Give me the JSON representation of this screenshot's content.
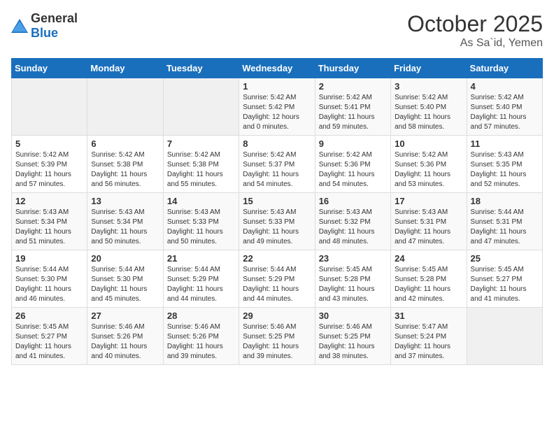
{
  "logo": {
    "text_general": "General",
    "text_blue": "Blue"
  },
  "title": {
    "month": "October 2025",
    "location": "As Sa`id, Yemen"
  },
  "weekdays": [
    "Sunday",
    "Monday",
    "Tuesday",
    "Wednesday",
    "Thursday",
    "Friday",
    "Saturday"
  ],
  "weeks": [
    [
      {
        "day": "",
        "info": ""
      },
      {
        "day": "",
        "info": ""
      },
      {
        "day": "",
        "info": ""
      },
      {
        "day": "1",
        "info": "Sunrise: 5:42 AM\nSunset: 5:42 PM\nDaylight: 12 hours and 0 minutes."
      },
      {
        "day": "2",
        "info": "Sunrise: 5:42 AM\nSunset: 5:41 PM\nDaylight: 11 hours and 59 minutes."
      },
      {
        "day": "3",
        "info": "Sunrise: 5:42 AM\nSunset: 5:40 PM\nDaylight: 11 hours and 58 minutes."
      },
      {
        "day": "4",
        "info": "Sunrise: 5:42 AM\nSunset: 5:40 PM\nDaylight: 11 hours and 57 minutes."
      }
    ],
    [
      {
        "day": "5",
        "info": "Sunrise: 5:42 AM\nSunset: 5:39 PM\nDaylight: 11 hours and 57 minutes."
      },
      {
        "day": "6",
        "info": "Sunrise: 5:42 AM\nSunset: 5:38 PM\nDaylight: 11 hours and 56 minutes."
      },
      {
        "day": "7",
        "info": "Sunrise: 5:42 AM\nSunset: 5:38 PM\nDaylight: 11 hours and 55 minutes."
      },
      {
        "day": "8",
        "info": "Sunrise: 5:42 AM\nSunset: 5:37 PM\nDaylight: 11 hours and 54 minutes."
      },
      {
        "day": "9",
        "info": "Sunrise: 5:42 AM\nSunset: 5:36 PM\nDaylight: 11 hours and 54 minutes."
      },
      {
        "day": "10",
        "info": "Sunrise: 5:42 AM\nSunset: 5:36 PM\nDaylight: 11 hours and 53 minutes."
      },
      {
        "day": "11",
        "info": "Sunrise: 5:43 AM\nSunset: 5:35 PM\nDaylight: 11 hours and 52 minutes."
      }
    ],
    [
      {
        "day": "12",
        "info": "Sunrise: 5:43 AM\nSunset: 5:34 PM\nDaylight: 11 hours and 51 minutes."
      },
      {
        "day": "13",
        "info": "Sunrise: 5:43 AM\nSunset: 5:34 PM\nDaylight: 11 hours and 50 minutes."
      },
      {
        "day": "14",
        "info": "Sunrise: 5:43 AM\nSunset: 5:33 PM\nDaylight: 11 hours and 50 minutes."
      },
      {
        "day": "15",
        "info": "Sunrise: 5:43 AM\nSunset: 5:33 PM\nDaylight: 11 hours and 49 minutes."
      },
      {
        "day": "16",
        "info": "Sunrise: 5:43 AM\nSunset: 5:32 PM\nDaylight: 11 hours and 48 minutes."
      },
      {
        "day": "17",
        "info": "Sunrise: 5:43 AM\nSunset: 5:31 PM\nDaylight: 11 hours and 47 minutes."
      },
      {
        "day": "18",
        "info": "Sunrise: 5:44 AM\nSunset: 5:31 PM\nDaylight: 11 hours and 47 minutes."
      }
    ],
    [
      {
        "day": "19",
        "info": "Sunrise: 5:44 AM\nSunset: 5:30 PM\nDaylight: 11 hours and 46 minutes."
      },
      {
        "day": "20",
        "info": "Sunrise: 5:44 AM\nSunset: 5:30 PM\nDaylight: 11 hours and 45 minutes."
      },
      {
        "day": "21",
        "info": "Sunrise: 5:44 AM\nSunset: 5:29 PM\nDaylight: 11 hours and 44 minutes."
      },
      {
        "day": "22",
        "info": "Sunrise: 5:44 AM\nSunset: 5:29 PM\nDaylight: 11 hours and 44 minutes."
      },
      {
        "day": "23",
        "info": "Sunrise: 5:45 AM\nSunset: 5:28 PM\nDaylight: 11 hours and 43 minutes."
      },
      {
        "day": "24",
        "info": "Sunrise: 5:45 AM\nSunset: 5:28 PM\nDaylight: 11 hours and 42 minutes."
      },
      {
        "day": "25",
        "info": "Sunrise: 5:45 AM\nSunset: 5:27 PM\nDaylight: 11 hours and 41 minutes."
      }
    ],
    [
      {
        "day": "26",
        "info": "Sunrise: 5:45 AM\nSunset: 5:27 PM\nDaylight: 11 hours and 41 minutes."
      },
      {
        "day": "27",
        "info": "Sunrise: 5:46 AM\nSunset: 5:26 PM\nDaylight: 11 hours and 40 minutes."
      },
      {
        "day": "28",
        "info": "Sunrise: 5:46 AM\nSunset: 5:26 PM\nDaylight: 11 hours and 39 minutes."
      },
      {
        "day": "29",
        "info": "Sunrise: 5:46 AM\nSunset: 5:25 PM\nDaylight: 11 hours and 39 minutes."
      },
      {
        "day": "30",
        "info": "Sunrise: 5:46 AM\nSunset: 5:25 PM\nDaylight: 11 hours and 38 minutes."
      },
      {
        "day": "31",
        "info": "Sunrise: 5:47 AM\nSunset: 5:24 PM\nDaylight: 11 hours and 37 minutes."
      },
      {
        "day": "",
        "info": ""
      }
    ]
  ]
}
